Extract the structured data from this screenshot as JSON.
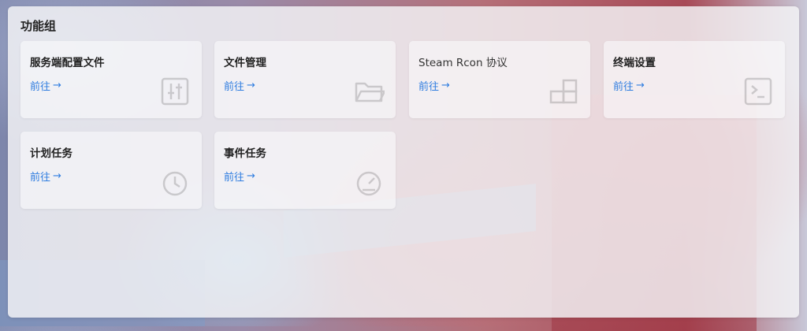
{
  "panel": {
    "title": "功能组"
  },
  "cards": [
    {
      "title": "服务端配置文件",
      "link": "前往",
      "icon": "config-file-icon"
    },
    {
      "title": "文件管理",
      "link": "前往",
      "icon": "folder-icon"
    },
    {
      "title": "Steam Rcon 协议",
      "link": "前往",
      "icon": "grid-icon"
    },
    {
      "title": "终端设置",
      "link": "前往",
      "icon": "terminal-icon"
    },
    {
      "title": "计划任务",
      "link": "前往",
      "icon": "clock-icon"
    },
    {
      "title": "事件任务",
      "link": "前往",
      "icon": "gauge-icon"
    }
  ],
  "colors": {
    "accent": "#2f7de0",
    "panel_bg": "#f3f3f6",
    "title": "#222222"
  }
}
